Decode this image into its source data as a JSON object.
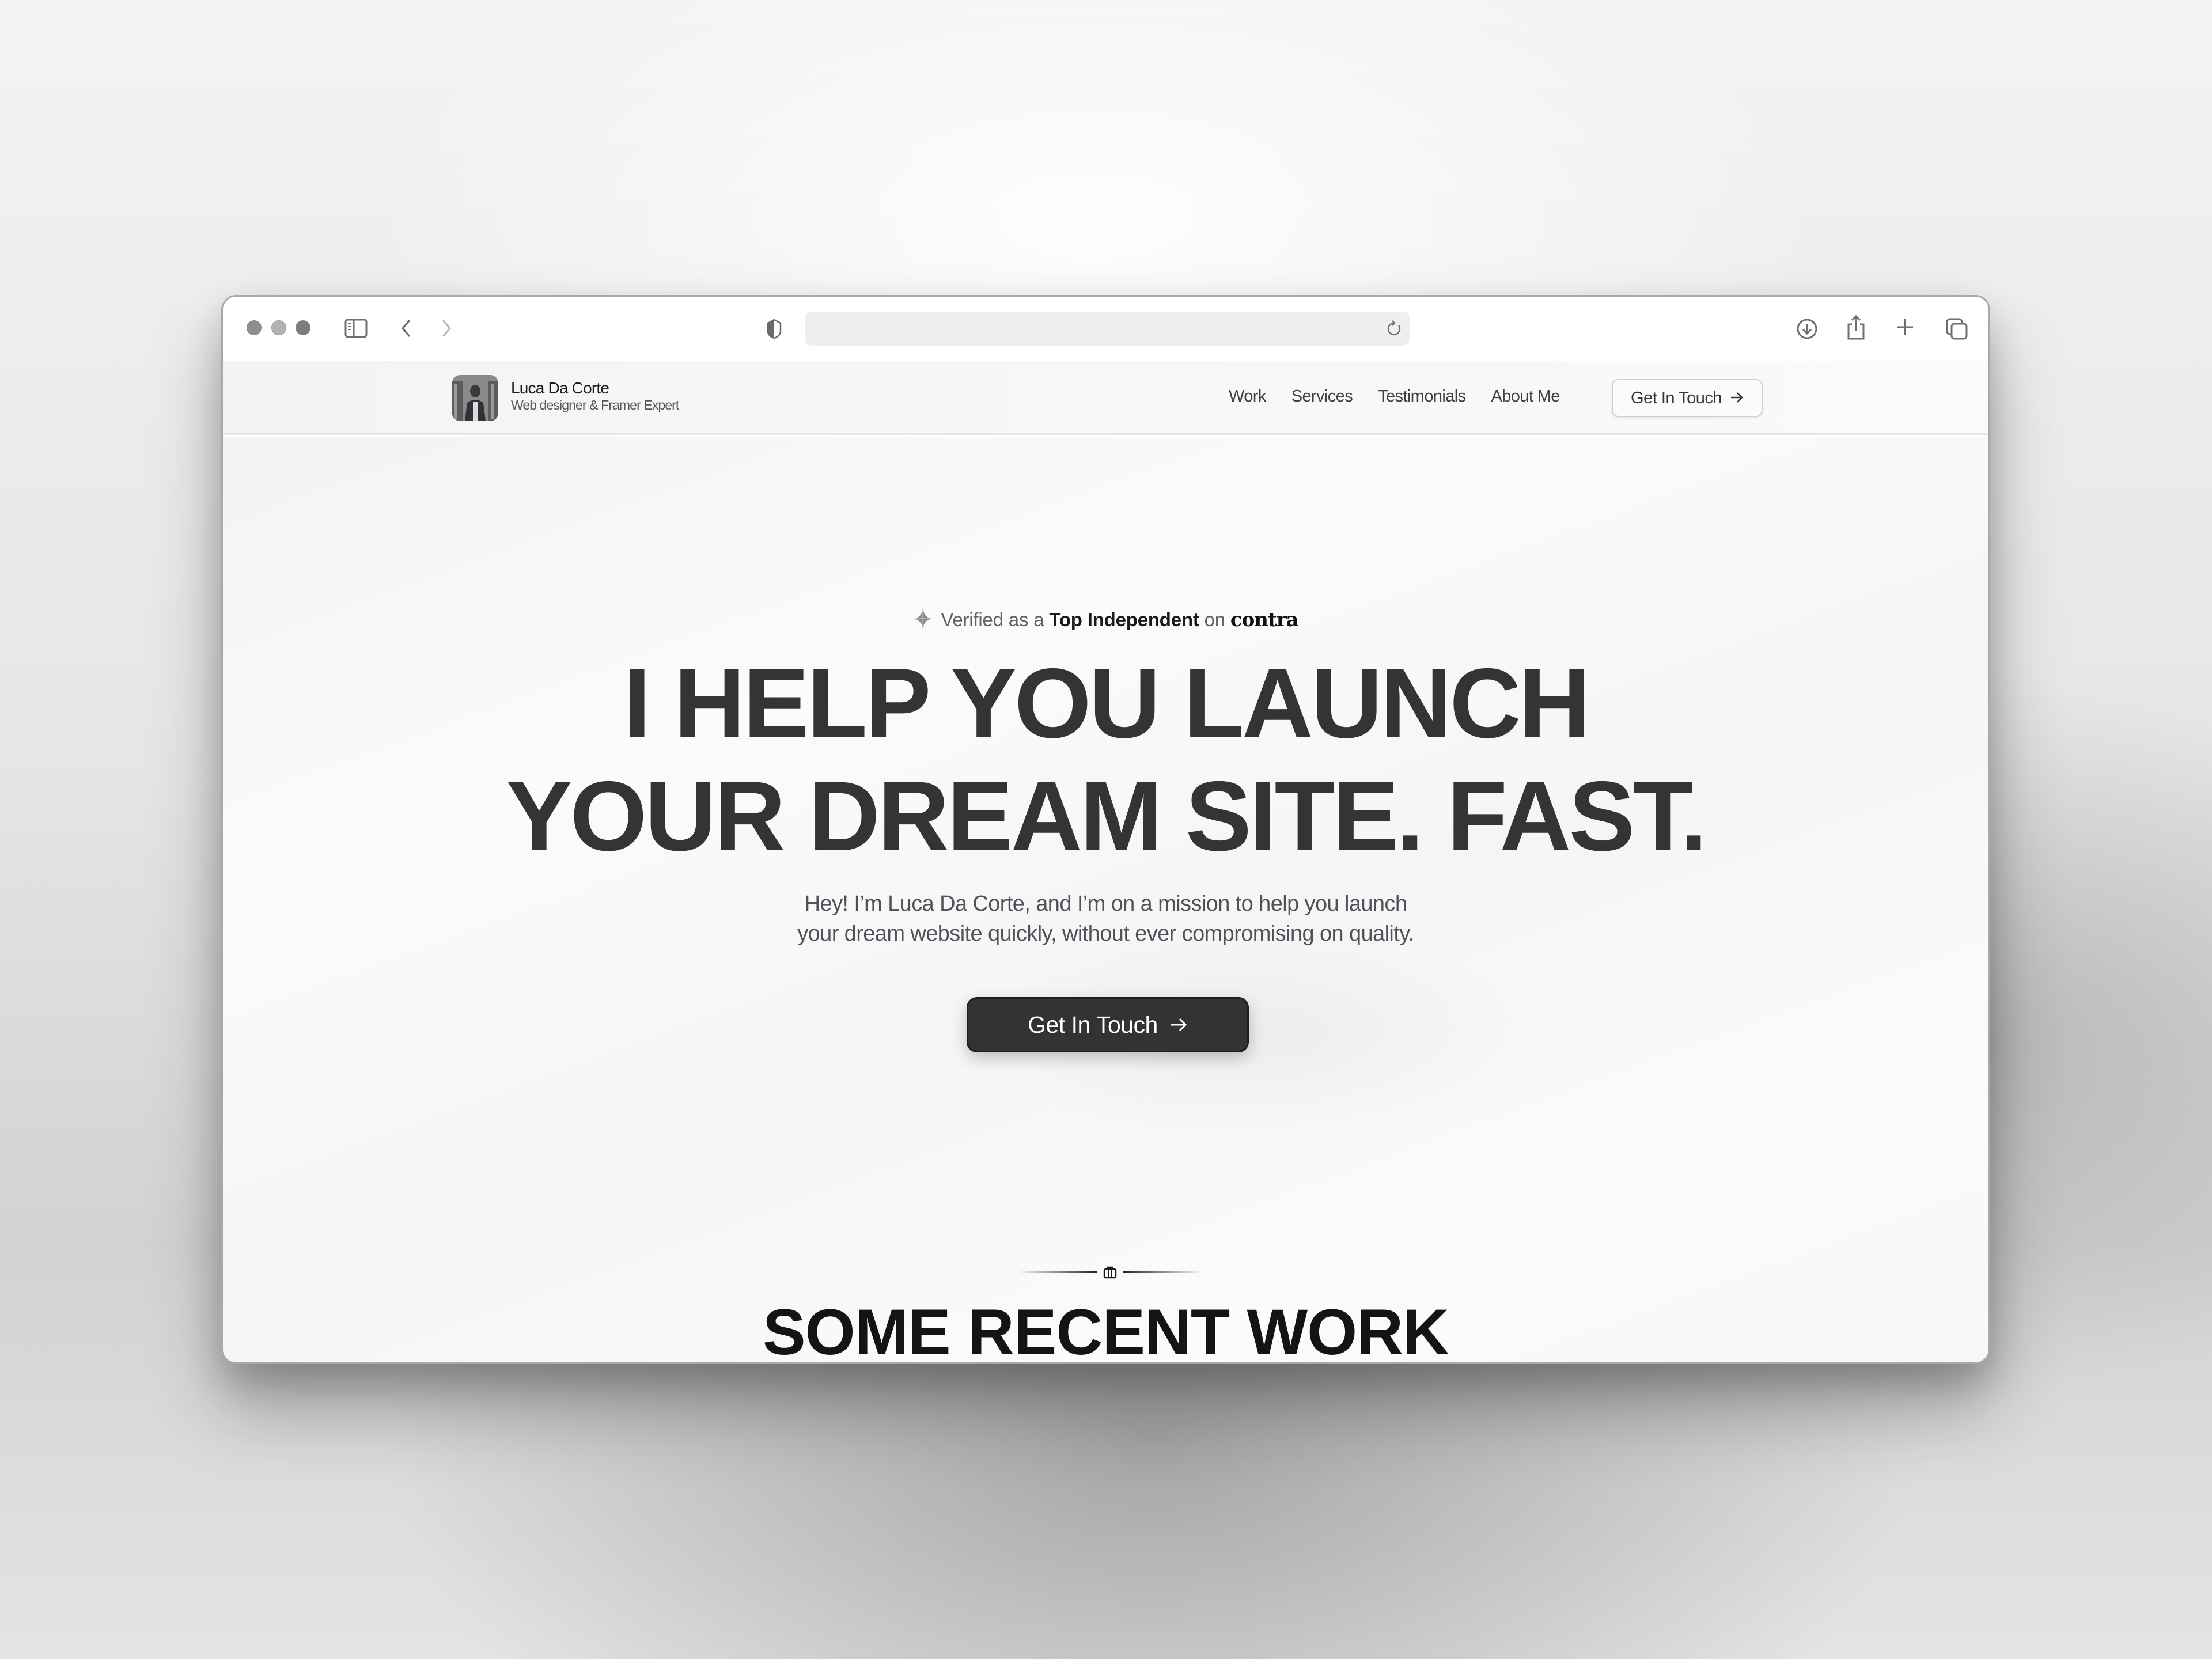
{
  "browser": {
    "traffic_lights": [
      "close",
      "minimize",
      "zoom"
    ],
    "toolbar_icons": {
      "sidebar": "sidebar-icon",
      "back": "chevron-left-icon",
      "forward": "chevron-right-icon",
      "privacy": "shield-icon",
      "reload": "reload-icon",
      "download": "download-icon",
      "share": "share-icon",
      "new_tab": "plus-icon",
      "tabs": "tabs-overview-icon"
    },
    "url": ""
  },
  "nav": {
    "brand_name": "Luca Da Corte",
    "brand_subtitle": "Web designer & Framer Expert",
    "links": [
      {
        "label": "Work"
      },
      {
        "label": "Services"
      },
      {
        "label": "Testimonials"
      },
      {
        "label": "About Me"
      }
    ],
    "cta_label": "Get In Touch",
    "cta_icon": "arrow-right-icon"
  },
  "hero": {
    "badge": {
      "prefix": "Verified as a",
      "highlight": "Top Independent",
      "connector": "on",
      "platform": "contra",
      "icon": "sparkle-icon"
    },
    "headline_line1": "I HELP YOU LAUNCH",
    "headline_line2": "YOUR DREAM SITE. FAST.",
    "subtitle_line1": "Hey! I’m Luca Da Corte, and I’m on a mission to help you launch",
    "subtitle_line2": "your dream website quickly, without ever compromising on quality.",
    "cta_label": "Get In Touch",
    "cta_icon": "arrow-right-icon"
  },
  "work_section": {
    "divider_icon": "briefcase-icon",
    "title": "SOME RECENT WORK"
  },
  "colors": {
    "headline": "#343434",
    "body_text": "#4e535a",
    "cta_bg": "#333333",
    "section_title": "#141414"
  }
}
